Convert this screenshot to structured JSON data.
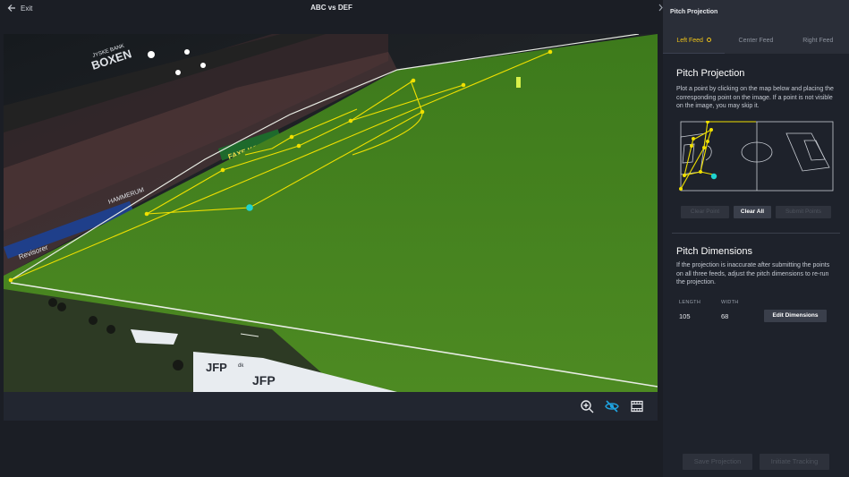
{
  "topbar": {
    "exit_label": "Exit",
    "match_title": "ABC vs DEF"
  },
  "video": {
    "toolbar_icons": [
      "zoom-in-icon",
      "hide-overlay-icon",
      "film-icon"
    ],
    "accent_color": "#f0e000",
    "selected_point_color": "#1fd3d0",
    "stadium_signs": {
      "roof_sign": "BOXEN",
      "bank_sign": "JYSKE BANK",
      "ad_1": "FAXE KONDI",
      "ad_2": "HAMMERUM",
      "ad_3": "Revisorer",
      "dugout_1": "JFP",
      "dugout_2": "JFP",
      "dugout_domain": "dk"
    }
  },
  "panel": {
    "header": "Pitch Projection",
    "tabs": [
      {
        "label": "Left Feed",
        "active": true
      },
      {
        "label": "Center Feed",
        "active": false
      },
      {
        "label": "Right Feed",
        "active": false
      }
    ],
    "projection": {
      "title": "Pitch Projection",
      "description": "Plot a point by clicking on the map below and placing the corresponding point on the image. If a point is not visible on the image, you may skip it.",
      "buttons": {
        "clear_point": "Clear Point",
        "clear_all": "Clear All",
        "submit_points": "Submit Points"
      }
    },
    "dimensions": {
      "title": "Pitch Dimensions",
      "description": "If the projection is inaccurate after submitting the points on all three feeds, adjust the pitch dimensions to re-run the projection.",
      "length_label": "LENGTH",
      "length_value": "105",
      "width_label": "WIDTH",
      "width_value": "68",
      "edit_button": "Edit Dimensions"
    },
    "footer": {
      "save_projection": "Save Projection",
      "initiate_tracking": "Initiate Tracking"
    }
  }
}
